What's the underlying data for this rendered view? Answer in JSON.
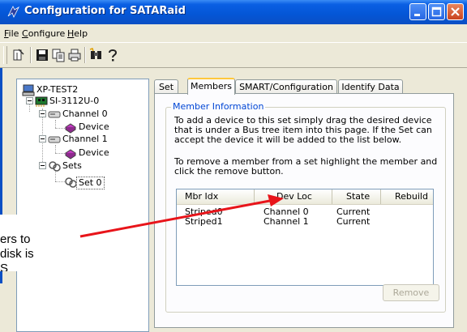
{
  "window": {
    "title": "Configuration for SATARaid"
  },
  "menu": [
    {
      "underline": "F",
      "rest": "ile"
    },
    {
      "underline": "C",
      "rest": "onfigure"
    },
    {
      "underline": "H",
      "rest": "elp"
    }
  ],
  "toolbar": {
    "icons": [
      "exit-icon",
      "save-icon",
      "copy-icon",
      "print-icon",
      "find-icon",
      "help-icon"
    ]
  },
  "tree": {
    "root": "XP-TEST2",
    "controller": "SI-3112U-0",
    "channel0": "Channel 0",
    "device0": "Device",
    "channel1": "Channel 1",
    "device1": "Device",
    "sets": "Sets",
    "set0": "Set 0"
  },
  "tabs": [
    "Set",
    "Members",
    "SMART/Configuration",
    "Identify Data"
  ],
  "active_tab": "Members",
  "member_info": {
    "title": "Member Information",
    "add_text": "To add a device to this set simply drag the desired device that is under a Bus tree item into this page.  If the Set can accept the device it will be added to the list below.",
    "remove_text": "To remove a member from a set highlight the member and click the remove button.",
    "columns": [
      "Mbr Idx",
      "Dev Loc",
      "State",
      "Rebuild"
    ],
    "rows": [
      {
        "mbr": "Striped0",
        "loc": "Channel 0",
        "state": "Current",
        "rebuild": ""
      },
      {
        "mbr": "Striped1",
        "loc": "Channel 1",
        "state": "Current",
        "rebuild": ""
      }
    ],
    "remove_button": "Remove"
  },
  "annotation": {
    "line1": "ers to",
    "line2": "disk is",
    "line3": "S",
    "arrow_color": "#e8141a"
  },
  "colors": {
    "titlebar": "#0456d6",
    "groupbox_title": "#0046d5",
    "disabled_text": "#aca899",
    "tab_highlight": "#ffc83c"
  }
}
